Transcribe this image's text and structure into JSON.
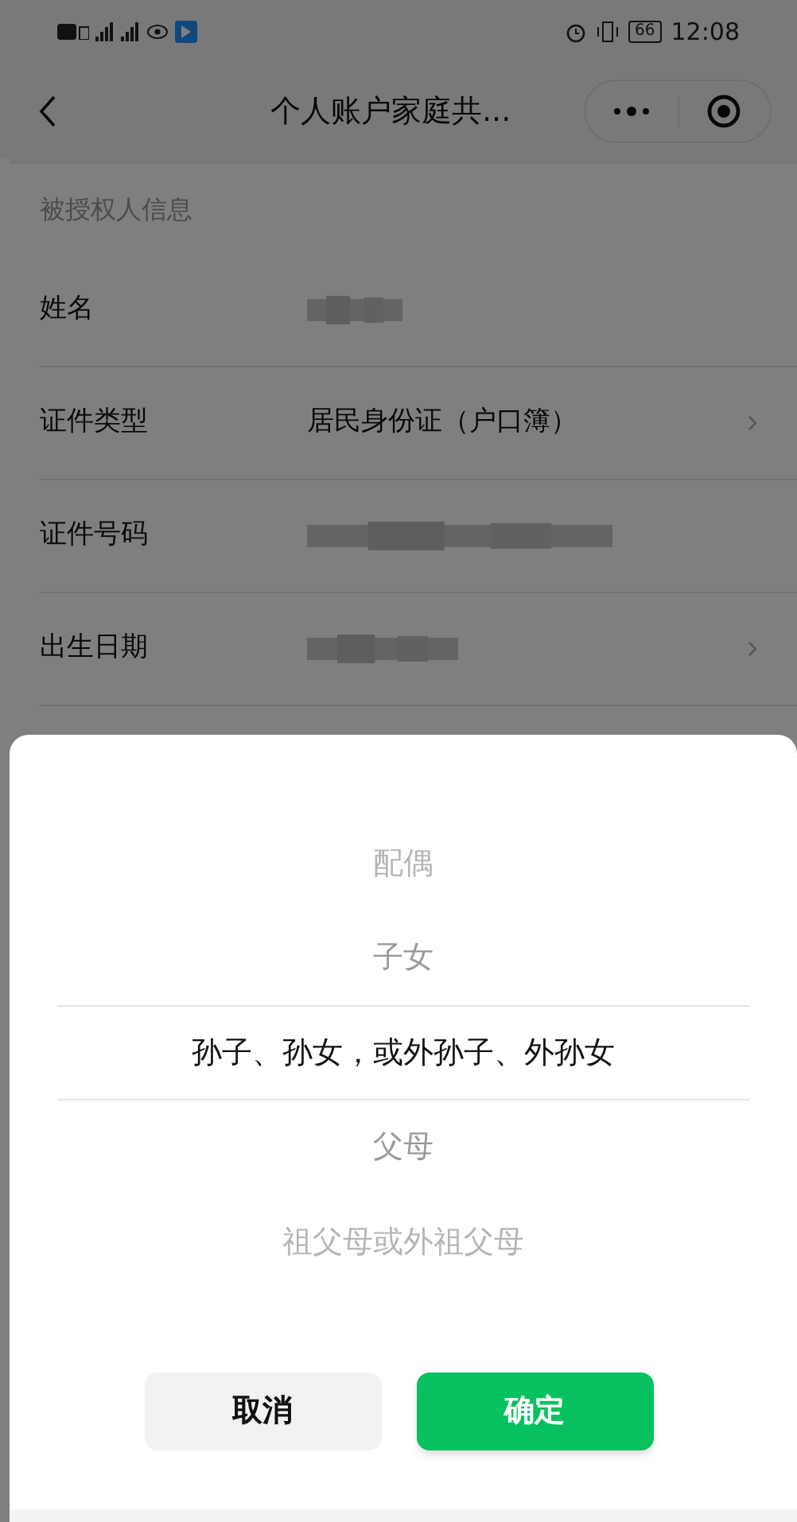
{
  "status_bar": {
    "battery": "66",
    "time": "12:08"
  },
  "header": {
    "title": "个人账户家庭共..."
  },
  "section": {
    "title": "被授权人信息",
    "rows": [
      {
        "label": "姓名",
        "kind": "redacted",
        "chevron": false
      },
      {
        "label": "证件类型",
        "kind": "text",
        "value": "居民身份证（户口簿）",
        "chevron": true
      },
      {
        "label": "证件号码",
        "kind": "redacted",
        "chevron": false
      },
      {
        "label": "出生日期",
        "kind": "redacted",
        "chevron": true
      }
    ]
  },
  "picker": {
    "options": [
      {
        "label": "配偶",
        "selected": false
      },
      {
        "label": "子女",
        "selected": false
      },
      {
        "label": "孙子、孙女，或外孙子、外孙女",
        "selected": true
      },
      {
        "label": "父母",
        "selected": false
      },
      {
        "label": "祖父母或外祖父母",
        "selected": false
      }
    ],
    "buttons": [
      {
        "label": "取消",
        "kind": "cancel"
      },
      {
        "label": "确定",
        "kind": "confirm"
      }
    ]
  }
}
